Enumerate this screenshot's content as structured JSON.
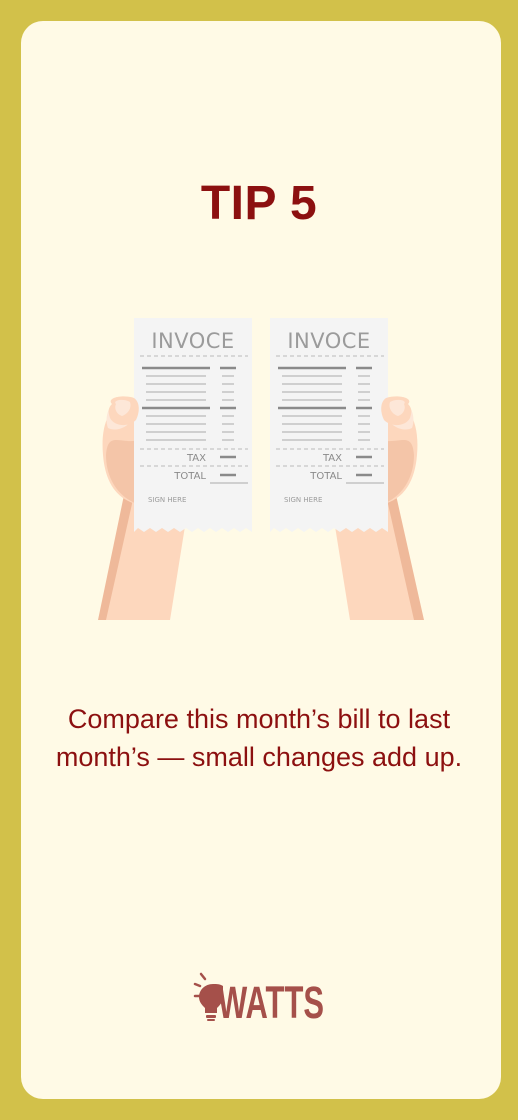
{
  "tip": {
    "title": "TIP 5",
    "message": "Compare this month’s bill to last month’s — small changes add up."
  },
  "illustration": {
    "receipt_left": {
      "heading": "INVOCE",
      "tax_label": "TAX",
      "total_label": "TOTAL",
      "sign_label": "SIGN HERE"
    },
    "receipt_right": {
      "heading": "INVOCE",
      "tax_label": "TAX",
      "total_label": "TOTAL",
      "sign_label": "SIGN HERE"
    }
  },
  "brand": {
    "name": "WATTS"
  },
  "colors": {
    "frame": "#d2c14a",
    "card": "#fffae6",
    "accent": "#8c1010",
    "brand": "#a5504a",
    "skin": "#fdd7bd",
    "skin_shadow": "#efb99a",
    "paper": "#f4f4f4",
    "ink": "#8a8a8a"
  }
}
